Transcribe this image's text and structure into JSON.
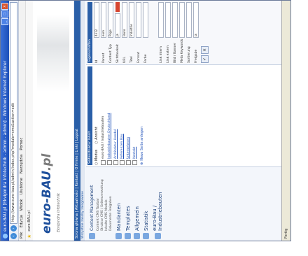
{
  "window": {
    "title": "euro-BAU.pl [Ekvipindra Infotechnik - admin - admin] - Windows Internet Explorer",
    "controls": [
      "_",
      "□",
      "×"
    ]
  },
  "address": {
    "url": "http://www.euro-bau.pl/admin/index.php?module=cms&action=edit"
  },
  "menubar": [
    "Plik",
    "Edycja",
    "Widok",
    "Ulubione",
    "Narzędzia",
    "Pomoc"
  ],
  "favbar": {
    "tab_label": "euro-BAU.pl"
  },
  "header": {
    "logo_main": "euro-BAU",
    "logo_suffix": ".pl",
    "tagline": "Ekvipindra Infotechnik",
    "topnav": "Strona główna | Aktualności | Kontakt | O firmie | Linki | Logout",
    "subnav": "Wszystkie zasoby zalogowane"
  },
  "sidebar": {
    "section_label": "Content Management",
    "items": [
      {
        "label": "Content Management",
        "icon": "folder-icon"
      },
      {
        "label": "Mandanten",
        "icon": "users-icon"
      },
      {
        "label": "Templates",
        "icon": "template-icon"
      },
      {
        "label": "Allgemein",
        "icon": "settings-icon"
      },
      {
        "label": "Statistik",
        "icon": "chart-icon"
      },
      {
        "label": "euro-Bau / Industriebauten",
        "icon": "page-icon"
      }
    ],
    "subitems": [
      "Content CMS Toolbar",
      "Struktur CMS / Seitenverwaltung",
      "Inhalte CMS Module",
      "Dokumente Freigaben"
    ]
  },
  "center": {
    "panel_title": "Seitenstruktur Inhalt",
    "radios": [
      "Modus",
      "Ansicht"
    ],
    "tree": [
      "euro-BAU / Industriebauten",
      "Industriebauten Deutschland",
      "Architektur Handel",
      "Referenzen Bau",
      "Unternehmen",
      "Kontakt"
    ],
    "add_label": "Neue Seite anlegen"
  },
  "properties": {
    "title": "Eigenschaften",
    "rows": [
      {
        "key": "Id",
        "value": "4312"
      },
      {
        "key": "Parent",
        "value": "euro"
      },
      {
        "key": "Content Typ",
        "value": "Page"
      },
      {
        "key": "Sichtbarkeit",
        "value": "ja"
      },
      {
        "key": "URL",
        "value": "/euro"
      },
      {
        "key": "Titel",
        "value": "Industrie"
      },
      {
        "key": "Format",
        "value": ""
      },
      {
        "key": "Farbe",
        "value": ""
      }
    ],
    "lower_rows": [
      {
        "key": "Link intern",
        "value": ""
      },
      {
        "key": "Link extern",
        "value": ""
      },
      {
        "key": "Bild / Banner",
        "value": ""
      },
      {
        "key": "Meta Keywords",
        "value": ""
      },
      {
        "key": "Sortierung",
        "value": ""
      },
      {
        "key": "Freigabe",
        "value": "ja"
      }
    ],
    "accent_color": "#d6452f"
  },
  "status": {
    "text": "Fertig"
  }
}
